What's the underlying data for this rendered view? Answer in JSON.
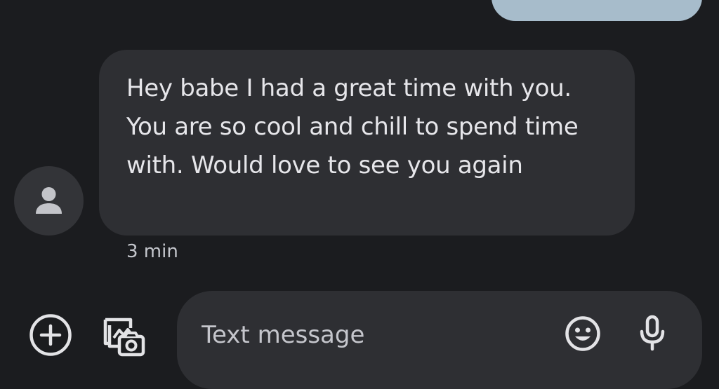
{
  "conversation": {
    "incoming_message": {
      "text": "Hey babe I had a great time with you. You are so cool and chill to spend time with. Would love to see you again",
      "timestamp": "3 min"
    },
    "avatar_icon": "person-icon"
  },
  "composer": {
    "placeholder": "Text message",
    "add_icon": "plus-circle-icon",
    "gallery_icon": "gallery-camera-icon",
    "emoji_icon": "emoji-icon",
    "mic_icon": "microphone-icon"
  },
  "colors": {
    "background": "#1b1c1f",
    "incoming_bubble": "#2e2f33",
    "outgoing_bubble": "#a7bccb",
    "text": "#e6e6ea",
    "secondary_text": "#c4c6cc"
  }
}
